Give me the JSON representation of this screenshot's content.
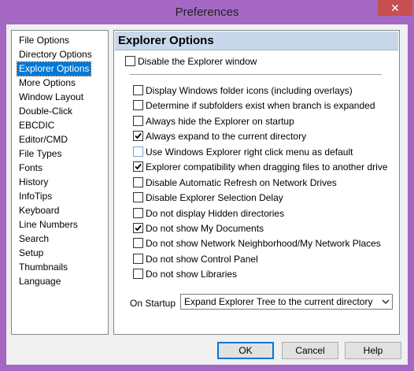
{
  "window": {
    "title": "Preferences",
    "close_glyph": "✕"
  },
  "sidebar": {
    "items": [
      {
        "label": "File Options"
      },
      {
        "label": "Directory Options"
      },
      {
        "label": "Explorer Options"
      },
      {
        "label": "More Options"
      },
      {
        "label": "Window Layout"
      },
      {
        "label": "Double-Click"
      },
      {
        "label": "EBCDIC"
      },
      {
        "label": "Editor/CMD"
      },
      {
        "label": "File Types"
      },
      {
        "label": "Fonts"
      },
      {
        "label": "History"
      },
      {
        "label": "InfoTips"
      },
      {
        "label": "Keyboard"
      },
      {
        "label": "Line Numbers"
      },
      {
        "label": "Search"
      },
      {
        "label": "Setup"
      },
      {
        "label": "Thumbnails"
      },
      {
        "label": "Language"
      }
    ],
    "selected": "Explorer Options"
  },
  "panel": {
    "title": "Explorer Options",
    "disable_window": {
      "label": "Disable the Explorer window",
      "checked": false
    },
    "options": [
      {
        "label": "Display Windows folder icons (including overlays)",
        "checked": false
      },
      {
        "label": "Determine if subfolders exist when branch is expanded",
        "checked": false
      },
      {
        "label": "Always hide the Explorer on startup",
        "checked": false
      },
      {
        "label": "Always expand to the current directory",
        "checked": true
      },
      {
        "label": "Use Windows Explorer right click menu as default",
        "checked": false
      },
      {
        "label": "Explorer compatibility when dragging files to another drive",
        "checked": true
      },
      {
        "label": "Disable Automatic Refresh on Network Drives",
        "checked": false
      },
      {
        "label": "Disable Explorer Selection Delay",
        "checked": false
      },
      {
        "label": "Do not display Hidden directories",
        "checked": false
      },
      {
        "label": "Do not show My Documents",
        "checked": true
      },
      {
        "label": "Do not show Network Neighborhood/My Network Places",
        "checked": false
      },
      {
        "label": "Do not show Control Panel",
        "checked": false
      },
      {
        "label": "Do not show Libraries",
        "checked": false
      }
    ],
    "startup": {
      "label": "On Startup",
      "value": "Expand Explorer Tree to the current directory"
    }
  },
  "buttons": {
    "ok": "OK",
    "cancel": "Cancel",
    "help": "Help"
  },
  "colors": {
    "selection": "#0078d7",
    "frame": "#a468c4",
    "header": "#c8d8ea"
  }
}
